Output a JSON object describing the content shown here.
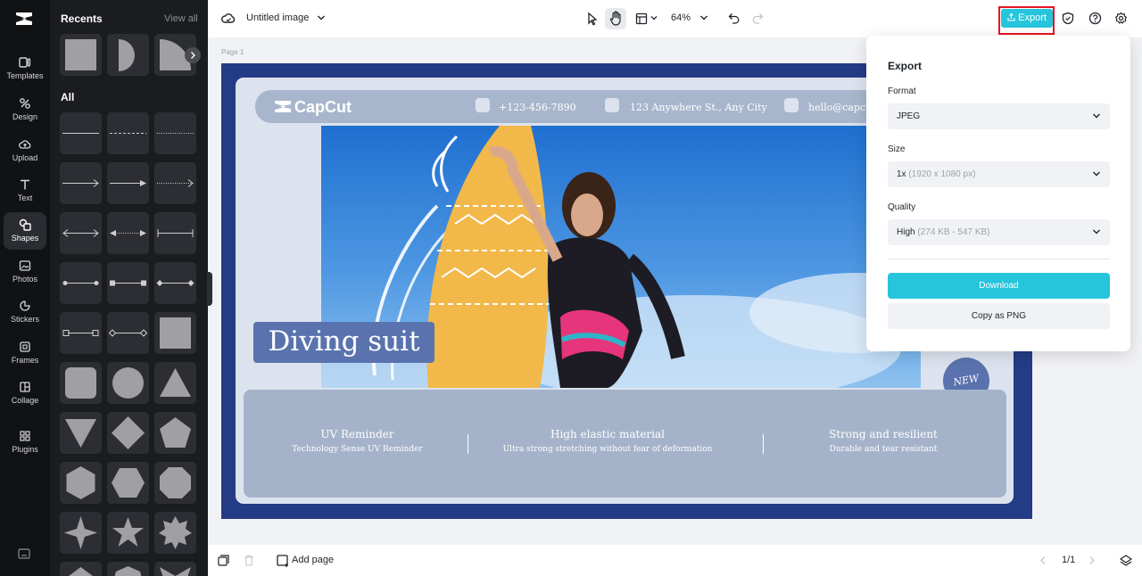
{
  "rail": {
    "items": [
      {
        "label": "Templates"
      },
      {
        "label": "Design"
      },
      {
        "label": "Upload"
      },
      {
        "label": "Text"
      },
      {
        "label": "Shapes"
      },
      {
        "label": "Photos"
      },
      {
        "label": "Stickers"
      },
      {
        "label": "Frames"
      },
      {
        "label": "Collage"
      },
      {
        "label": "Plugins"
      }
    ],
    "active": "Shapes"
  },
  "panel": {
    "recents_label": "Recents",
    "view_all_label": "View all",
    "all_label": "All"
  },
  "topbar": {
    "title": "Untitled image",
    "zoom": "64%",
    "export_label": "Export"
  },
  "canvas": {
    "page_label": "Page 1",
    "design": {
      "brand": "CapCut",
      "phone": "+123-456-7890",
      "address": "123 Anywhere St., Any City",
      "email": "hello@capcut.",
      "headline": "Diving suit",
      "badge": "NEW",
      "features": [
        {
          "title": "UV Reminder",
          "desc": "Technology Sense UV Reminder"
        },
        {
          "title": "High elastic material",
          "desc": "Ultra strong stretching without fear of deformation"
        },
        {
          "title": "Strong and resilient",
          "desc": "Durable and tear resistant"
        }
      ]
    }
  },
  "bottombar": {
    "add_page_label": "Add page",
    "page_count": "1/1"
  },
  "export_panel": {
    "heading": "Export",
    "format_label": "Format",
    "format_value": "JPEG",
    "size_label": "Size",
    "size_value": "1x",
    "size_detail": "(1920 x 1080 px)",
    "quality_label": "Quality",
    "quality_value": "High",
    "quality_detail": "(274 KB - 547 KB)",
    "download_label": "Download",
    "copy_png_label": "Copy as PNG"
  },
  "colors": {
    "accent": "#27c5dc",
    "highlight": "#e8141f",
    "design_navy": "#243b86",
    "design_badge": "#5a73ae"
  }
}
